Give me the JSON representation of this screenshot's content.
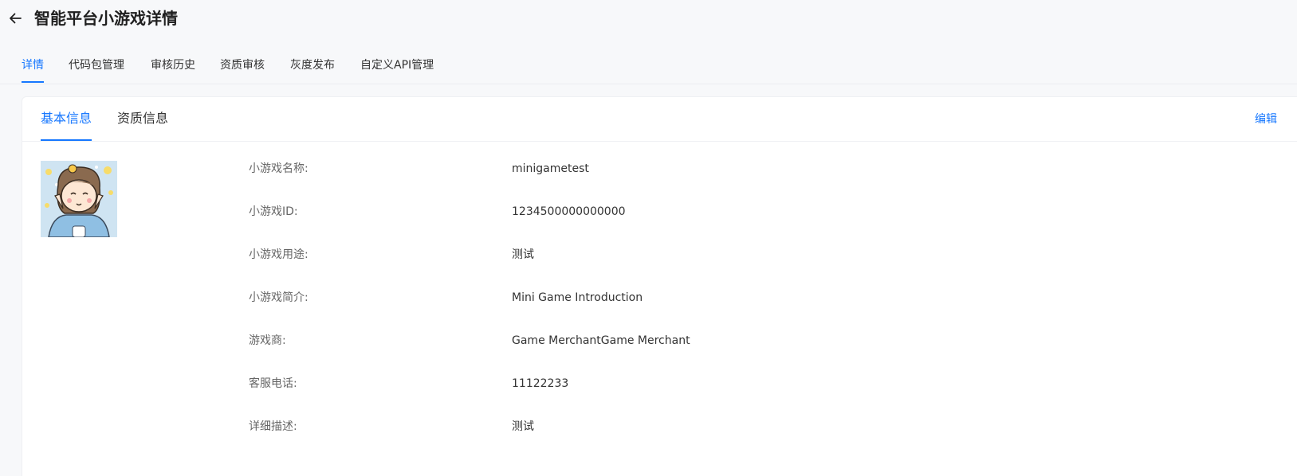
{
  "header": {
    "title": "智能平台小游戏详情",
    "back_icon": "arrow-left-icon"
  },
  "top_tabs": [
    {
      "label": "详情",
      "active": true
    },
    {
      "label": "代码包管理",
      "active": false
    },
    {
      "label": "审核历史",
      "active": false
    },
    {
      "label": "资质审核",
      "active": false
    },
    {
      "label": "灰度发布",
      "active": false
    },
    {
      "label": "自定义API管理",
      "active": false
    }
  ],
  "card": {
    "tabs": [
      {
        "label": "基本信息",
        "active": true
      },
      {
        "label": "资质信息",
        "active": false
      }
    ],
    "edit_label": "编辑",
    "fields": [
      {
        "label": "小游戏名称:",
        "value": "minigametest"
      },
      {
        "label": "小游戏ID:",
        "value": "1234500000000000"
      },
      {
        "label": "小游戏用途:",
        "value": "测试"
      },
      {
        "label": "小游戏简介:",
        "value": "Mini Game Introduction"
      },
      {
        "label": "游戏商:",
        "value": "Game MerchantGame Merchant"
      },
      {
        "label": "客服电话:",
        "value": "11122233"
      },
      {
        "label": "详细描述:",
        "value": "测试"
      }
    ]
  },
  "colors": {
    "accent": "#1677ff",
    "background": "#f7f8fa",
    "card": "#ffffff",
    "text": "#333333",
    "label": "#666666"
  }
}
